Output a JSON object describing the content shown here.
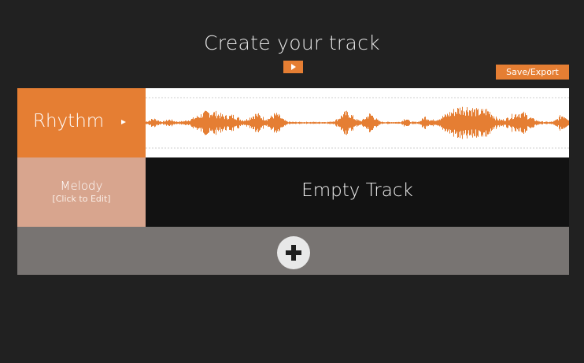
{
  "header": {
    "title": "Create your track",
    "play_all_icon": "play-icon",
    "save_label": "Save/Export"
  },
  "colors": {
    "background": "#212121",
    "accent": "#e57e33",
    "melody_label": "#d8a58e",
    "empty_lane": "#121212",
    "add_row": "#787472",
    "waveform": "#e57e33"
  },
  "tracks": [
    {
      "name": "Rhythm",
      "icon": "play-icon",
      "lane": "waveform"
    },
    {
      "name": "Melody",
      "hint": "[Click to Edit]",
      "lane_text": "Empty Track"
    }
  ],
  "add_track": {
    "icon": "plus-icon"
  }
}
